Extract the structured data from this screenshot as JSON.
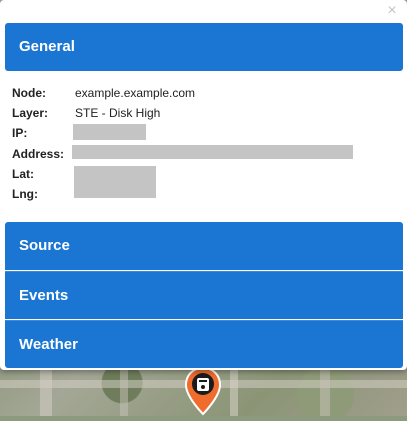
{
  "popup": {
    "close_glyph": "×",
    "sections": {
      "general": "General",
      "source": "Source",
      "events": "Events",
      "weather": "Weather"
    },
    "details": {
      "node_label": "Node:",
      "node_value": "example.example.com",
      "layer_label": "Layer:",
      "layer_value": "STE - Disk High",
      "ip_label": "IP:",
      "address_label": "Address:",
      "lat_label": "Lat:",
      "lng_label": "Lng:"
    }
  },
  "colors": {
    "header_blue": "#1a76d2",
    "marker_orange": "#ef6c2d",
    "redaction_gray": "#c4c4c4"
  },
  "icons": {
    "close": "close-icon",
    "marker": "map-marker-icon"
  }
}
